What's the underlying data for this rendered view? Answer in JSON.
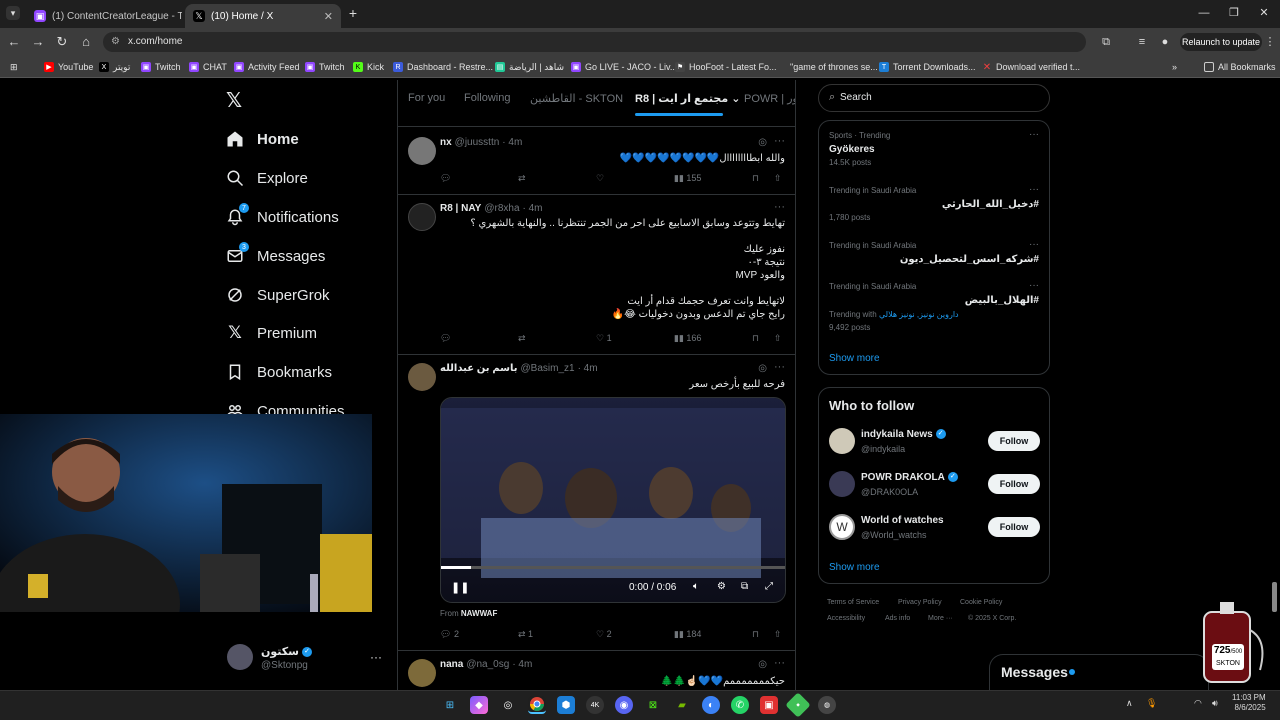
{
  "browser": {
    "tabs": [
      {
        "title": "(1) ContentCreatorLeague - Twi",
        "active": false
      },
      {
        "title": "(10) Home / X",
        "active": true
      }
    ],
    "url": "x.com/home",
    "relaunch_label": "Relaunch to update",
    "bookmarks": [
      "YouTube",
      "تويتر",
      "Twitch",
      "CHAT",
      "Activity Feed",
      "Twitch",
      "Kick",
      "Dashboard - Restre...",
      "شاهد | الرياضة",
      "Go LIVE - JACO - Liv...",
      "HooFoot - Latest Fo...",
      "\"game of thrones se...",
      "Torrent Downloads...",
      "Download verified t..."
    ],
    "all_bookmarks": "All Bookmarks"
  },
  "sidebar": {
    "items": [
      {
        "label": "Home",
        "icon": "home-icon",
        "badge": ""
      },
      {
        "label": "Explore",
        "icon": "search-icon",
        "badge": ""
      },
      {
        "label": "Notifications",
        "icon": "bell-icon",
        "badge": "7"
      },
      {
        "label": "Messages",
        "icon": "mail-icon",
        "badge": "3"
      },
      {
        "label": "SuperGrok",
        "icon": "grok-icon",
        "badge": ""
      },
      {
        "label": "Premium",
        "icon": "x-logo-icon",
        "badge": ""
      },
      {
        "label": "Bookmarks",
        "icon": "bookmark-icon",
        "badge": ""
      },
      {
        "label": "Communities",
        "icon": "communities-icon",
        "badge": ""
      }
    ],
    "account": {
      "name": "سكتون",
      "handle": "@Sktonpg"
    }
  },
  "feed": {
    "tabs": [
      "For you",
      "Following",
      "القاطشين - SKTON",
      "R8 | مجتمع ار ايت",
      "POWR | باور"
    ],
    "posts": [
      {
        "name": "nx",
        "handle": "@juussttn",
        "time": "· 4m",
        "text": "والله ابطاااااااال💙💙💙💙💙💙💙💙",
        "replies": "",
        "reposts": "",
        "likes": "",
        "views": "155"
      },
      {
        "name": "R8 | NAY",
        "handle": "@r8xha",
        "time": "· 4m",
        "text": "تهايط وتتوعد وسابق الاسابيع على احر من الجمر تنتظرنا .. والنهاية بالشهري ؟\n\nنفوز عليك\nنتيجة ٣-٠\nوالعود MVP\n\nلاتهايط وانت تعرف حجمك قدام أر ايت\nرايح جاي تم الدعس وبدون دخوليات 😂🔥",
        "replies": "",
        "reposts": "",
        "likes": "1",
        "views": "166"
      },
      {
        "name": "باسم بن عبدالله",
        "handle": "@Basim_z1",
        "time": "· 4m",
        "text": "فرحه للبيع بأرخص سعر",
        "video_time": "0:00 / 0:06",
        "from_label": "From",
        "from_name": "NAWWAF",
        "replies": "2",
        "reposts": "1",
        "likes": "2",
        "views": "184"
      },
      {
        "name": "nana",
        "handle": "@na_0sg",
        "time": "· 4m",
        "text": "حيكمممممممم💙💙☝🏻🌲🌲",
        "replies": "",
        "reposts": "",
        "likes": "",
        "views": ""
      }
    ]
  },
  "search": {
    "placeholder": "Search"
  },
  "trends": [
    {
      "meta": "Sports · Trending",
      "name": "Gyökeres",
      "count": "14.5K posts",
      "extra": ""
    },
    {
      "meta": "Trending in Saudi Arabia",
      "name": "#دخيل_الله_الحارثي",
      "count": "1,780 posts",
      "extra": ""
    },
    {
      "meta": "Trending in Saudi Arabia",
      "name": "#شركه_اسس_لتحصيل_ديون",
      "count": "",
      "extra": ""
    },
    {
      "meta": "Trending in Saudi Arabia",
      "name": "#الهلال_بالبيض",
      "count": "9,492 posts",
      "extra_prefix": "Trending with",
      "extra": "داروين نونيز, نونيز هلالي"
    }
  ],
  "trends_show_more": "Show more",
  "who_to_follow": {
    "title": "Who to follow",
    "accounts": [
      {
        "name": "indykaila News",
        "handle": "@indykaila",
        "button": "Follow"
      },
      {
        "name": "POWR DRAKOLA",
        "handle": "@DRAK0OLA",
        "button": "Follow"
      },
      {
        "name": "World of watches",
        "handle": "@World_watchs",
        "button": "Follow"
      }
    ],
    "show_more": "Show more"
  },
  "footer": [
    "Terms of Service",
    "Privacy Policy",
    "Cookie Policy",
    "Accessibility",
    "Ads info",
    "More ···",
    "© 2025 X Corp."
  ],
  "messages_drawer": "Messages",
  "overlay": {
    "counter": "725",
    "counter_total": "/500",
    "counter_label": "SKTON"
  },
  "clock": {
    "time": "11:03 PM",
    "date": "8/6/2025"
  },
  "colors": {
    "accent": "#1d9bf0",
    "bg": "#000000",
    "border": "#2f3336",
    "muted": "#71767b"
  }
}
